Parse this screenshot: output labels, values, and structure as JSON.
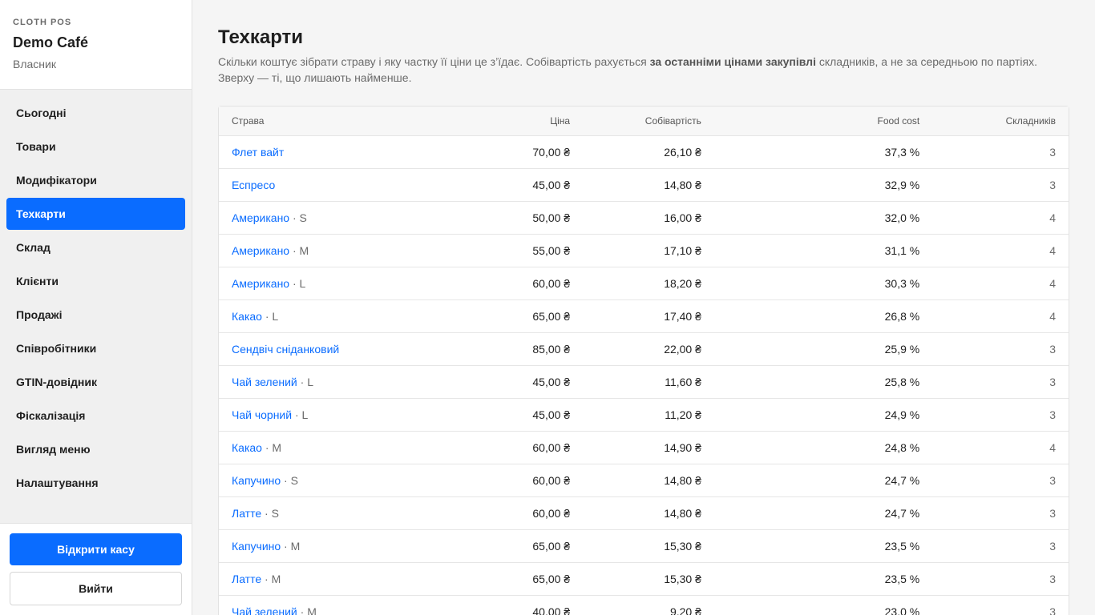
{
  "brand": {
    "app": "CLOTH POS",
    "name": "Demo Café",
    "role": "Власник"
  },
  "nav": [
    {
      "label": "Сьогодні",
      "active": false
    },
    {
      "label": "Товари",
      "active": false
    },
    {
      "label": "Модифікатори",
      "active": false
    },
    {
      "label": "Техкарти",
      "active": true
    },
    {
      "label": "Склад",
      "active": false
    },
    {
      "label": "Клієнти",
      "active": false
    },
    {
      "label": "Продажі",
      "active": false
    },
    {
      "label": "Співробітники",
      "active": false
    },
    {
      "label": "GTIN-довідник",
      "active": false
    },
    {
      "label": "Фіскалізація",
      "active": false
    },
    {
      "label": "Вигляд меню",
      "active": false
    },
    {
      "label": "Налаштування",
      "active": false
    }
  ],
  "footer": {
    "open_register": "Відкрити касу",
    "logout": "Вийти"
  },
  "page": {
    "title": "Техкарти",
    "desc_before": "Скільки коштує зібрати страву і яку частку її ціни це з’їдає. Собівартість рахується ",
    "desc_bold": "за останніми цінами закупівлі",
    "desc_after": " складників, а не за середньою по партіях. Зверху — ті, що лишають найменше."
  },
  "table": {
    "headers": {
      "dish": "Страва",
      "price": "Ціна",
      "cost": "Собівартість",
      "food_cost": "Food cost",
      "ingredients": "Складників"
    },
    "rows": [
      {
        "dish": "Флет вайт",
        "variant": "",
        "price": "70,00 ₴",
        "cost": "26,10 ₴",
        "food_cost": "37,3 %",
        "ingredients": "3"
      },
      {
        "dish": "Еспресо",
        "variant": "",
        "price": "45,00 ₴",
        "cost": "14,80 ₴",
        "food_cost": "32,9 %",
        "ingredients": "3"
      },
      {
        "dish": "Американо",
        "variant": " · S",
        "price": "50,00 ₴",
        "cost": "16,00 ₴",
        "food_cost": "32,0 %",
        "ingredients": "4"
      },
      {
        "dish": "Американо",
        "variant": " · M",
        "price": "55,00 ₴",
        "cost": "17,10 ₴",
        "food_cost": "31,1 %",
        "ingredients": "4"
      },
      {
        "dish": "Американо",
        "variant": " · L",
        "price": "60,00 ₴",
        "cost": "18,20 ₴",
        "food_cost": "30,3 %",
        "ingredients": "4"
      },
      {
        "dish": "Какао",
        "variant": " · L",
        "price": "65,00 ₴",
        "cost": "17,40 ₴",
        "food_cost": "26,8 %",
        "ingredients": "4"
      },
      {
        "dish": "Сендвіч сніданковий",
        "variant": "",
        "price": "85,00 ₴",
        "cost": "22,00 ₴",
        "food_cost": "25,9 %",
        "ingredients": "3"
      },
      {
        "dish": "Чай зелений",
        "variant": " · L",
        "price": "45,00 ₴",
        "cost": "11,60 ₴",
        "food_cost": "25,8 %",
        "ingredients": "3"
      },
      {
        "dish": "Чай чорний",
        "variant": " · L",
        "price": "45,00 ₴",
        "cost": "11,20 ₴",
        "food_cost": "24,9 %",
        "ingredients": "3"
      },
      {
        "dish": "Какао",
        "variant": " · M",
        "price": "60,00 ₴",
        "cost": "14,90 ₴",
        "food_cost": "24,8 %",
        "ingredients": "4"
      },
      {
        "dish": "Капучино",
        "variant": " · S",
        "price": "60,00 ₴",
        "cost": "14,80 ₴",
        "food_cost": "24,7 %",
        "ingredients": "3"
      },
      {
        "dish": "Латте",
        "variant": " · S",
        "price": "60,00 ₴",
        "cost": "14,80 ₴",
        "food_cost": "24,7 %",
        "ingredients": "3"
      },
      {
        "dish": "Капучино",
        "variant": " · M",
        "price": "65,00 ₴",
        "cost": "15,30 ₴",
        "food_cost": "23,5 %",
        "ingredients": "3"
      },
      {
        "dish": "Латте",
        "variant": " · M",
        "price": "65,00 ₴",
        "cost": "15,30 ₴",
        "food_cost": "23,5 %",
        "ingredients": "3"
      },
      {
        "dish": "Чай зелений",
        "variant": " · M",
        "price": "40,00 ₴",
        "cost": "9,20 ₴",
        "food_cost": "23,0 %",
        "ingredients": "3"
      }
    ]
  },
  "colors": {
    "accent": "#0a6cff",
    "sidebar_bg": "#f0f0f0",
    "main_bg": "#f5f5f5"
  }
}
